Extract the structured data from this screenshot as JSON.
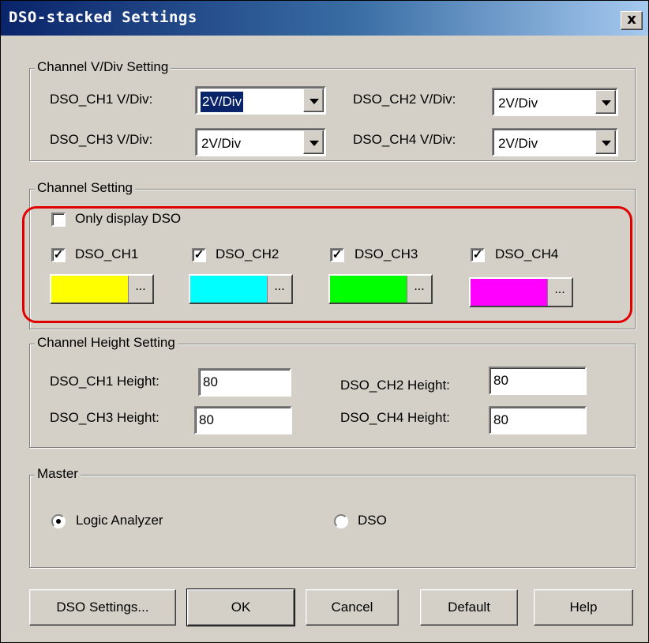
{
  "window": {
    "title": "DSO-stacked Settings",
    "close_glyph": "x"
  },
  "vdiv": {
    "legend": "Channel V/Div Setting",
    "rows": [
      {
        "label": "DSO_CH1 V/Div:",
        "value": "2V/Div"
      },
      {
        "label": "DSO_CH2 V/Div:",
        "value": "2V/Div"
      },
      {
        "label": "DSO_CH3 V/Div:",
        "value": "2V/Div"
      },
      {
        "label": "DSO_CH4 V/Div:",
        "value": "2V/Div"
      }
    ]
  },
  "channel": {
    "legend": "Channel Setting",
    "only_display": {
      "label": "Only display DSO",
      "checked": false
    },
    "channels": [
      {
        "label": "DSO_CH1",
        "checked": true,
        "color": "#ffff00"
      },
      {
        "label": "DSO_CH2",
        "checked": true,
        "color": "#00ffff"
      },
      {
        "label": "DSO_CH3",
        "checked": true,
        "color": "#00ff00"
      },
      {
        "label": "DSO_CH4",
        "checked": true,
        "color": "#ff00ff"
      }
    ],
    "color_button_label": "..."
  },
  "height": {
    "legend": "Channel Height Setting",
    "rows": [
      {
        "label": "DSO_CH1 Height:",
        "value": "80"
      },
      {
        "label": "DSO_CH2 Height:",
        "value": "80"
      },
      {
        "label": "DSO_CH3 Height:",
        "value": "80"
      },
      {
        "label": "DSO_CH4 Height:",
        "value": "80"
      }
    ]
  },
  "master": {
    "legend": "Master",
    "options": [
      {
        "label": "Logic Analyzer",
        "selected": true
      },
      {
        "label": "DSO",
        "selected": false
      }
    ]
  },
  "buttons": {
    "dso_settings": "DSO Settings...",
    "ok": "OK",
    "cancel": "Cancel",
    "default": "Default",
    "help": "Help"
  },
  "annotation": {
    "highlight_color": "#e00000"
  }
}
